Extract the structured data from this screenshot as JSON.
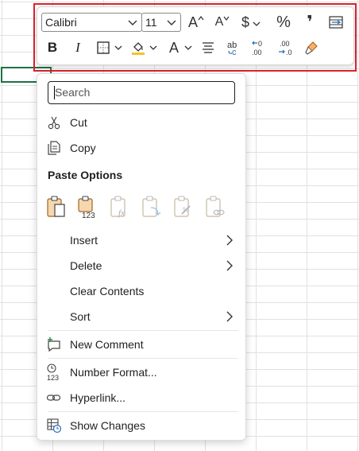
{
  "toolbar": {
    "font_name": "Calibri",
    "font_size": "11",
    "bold": "B",
    "italic": "I",
    "font_color_letter": "A",
    "grow_font": "A",
    "shrink_font": "A",
    "currency": "$",
    "percent": "%",
    "comma": "❜",
    "fill_color": "#f6c12a",
    "annotation_color": "#d9232d"
  },
  "menu": {
    "search_placeholder": "Search",
    "cut": "Cut",
    "copy": "Copy",
    "paste_options": "Paste Options",
    "paste_values_badge": "123",
    "insert": "Insert",
    "delete": "Delete",
    "clear_contents": "Clear Contents",
    "sort": "Sort",
    "new_comment": "New Comment",
    "number_format": "Number Format...",
    "number_format_badge": "123",
    "hyperlink": "Hyperlink...",
    "show_changes": "Show Changes"
  },
  "icons": [
    "chevron-down-icon",
    "increase-font-icon",
    "decrease-font-icon",
    "currency-icon",
    "percent-icon",
    "comma-style-icon",
    "wrap-text-icon",
    "borders-icon",
    "fill-color-icon",
    "font-color-icon",
    "align-center-icon",
    "strikethrough-icon",
    "decrease-decimal-icon",
    "increase-decimal-icon",
    "format-painter-icon",
    "scissors-icon",
    "copy-icon",
    "paste-icon",
    "paste-values-icon",
    "paste-formulas-icon",
    "paste-transpose-icon",
    "paste-formatting-icon",
    "paste-link-icon",
    "chevron-right-icon",
    "comment-icon",
    "number-format-icon",
    "hyperlink-icon",
    "show-changes-icon"
  ]
}
